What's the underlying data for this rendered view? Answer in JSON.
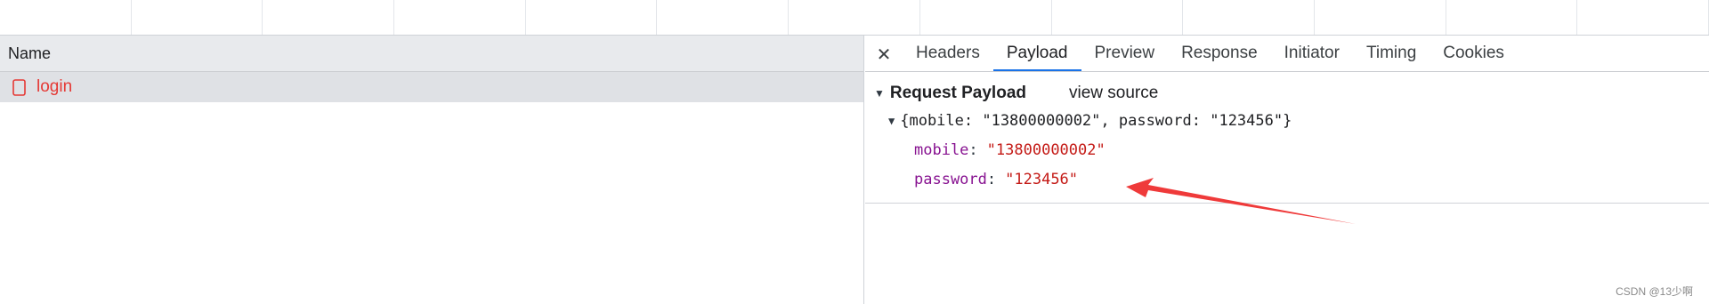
{
  "network": {
    "columns": {
      "name": "Name"
    },
    "requests": [
      {
        "name": "login"
      }
    ]
  },
  "details": {
    "tabs": [
      "Headers",
      "Payload",
      "Preview",
      "Response",
      "Initiator",
      "Timing",
      "Cookies"
    ],
    "active_tab": "Payload",
    "payload": {
      "section_title": "Request Payload",
      "view_source": "view source",
      "summary": "{mobile: \"13800000002\", password: \"123456\"}",
      "props": [
        {
          "key": "mobile",
          "value": "\"13800000002\""
        },
        {
          "key": "password",
          "value": "\"123456\""
        }
      ]
    }
  },
  "watermark": "CSDN @13少啊",
  "colors": {
    "accent": "#1a73e8",
    "request_name": "#e53935",
    "annotation_arrow": "#ef3a3a"
  },
  "icons": {
    "request_type": "document-icon",
    "close": "close-icon",
    "expand": "triangle-down-icon"
  }
}
